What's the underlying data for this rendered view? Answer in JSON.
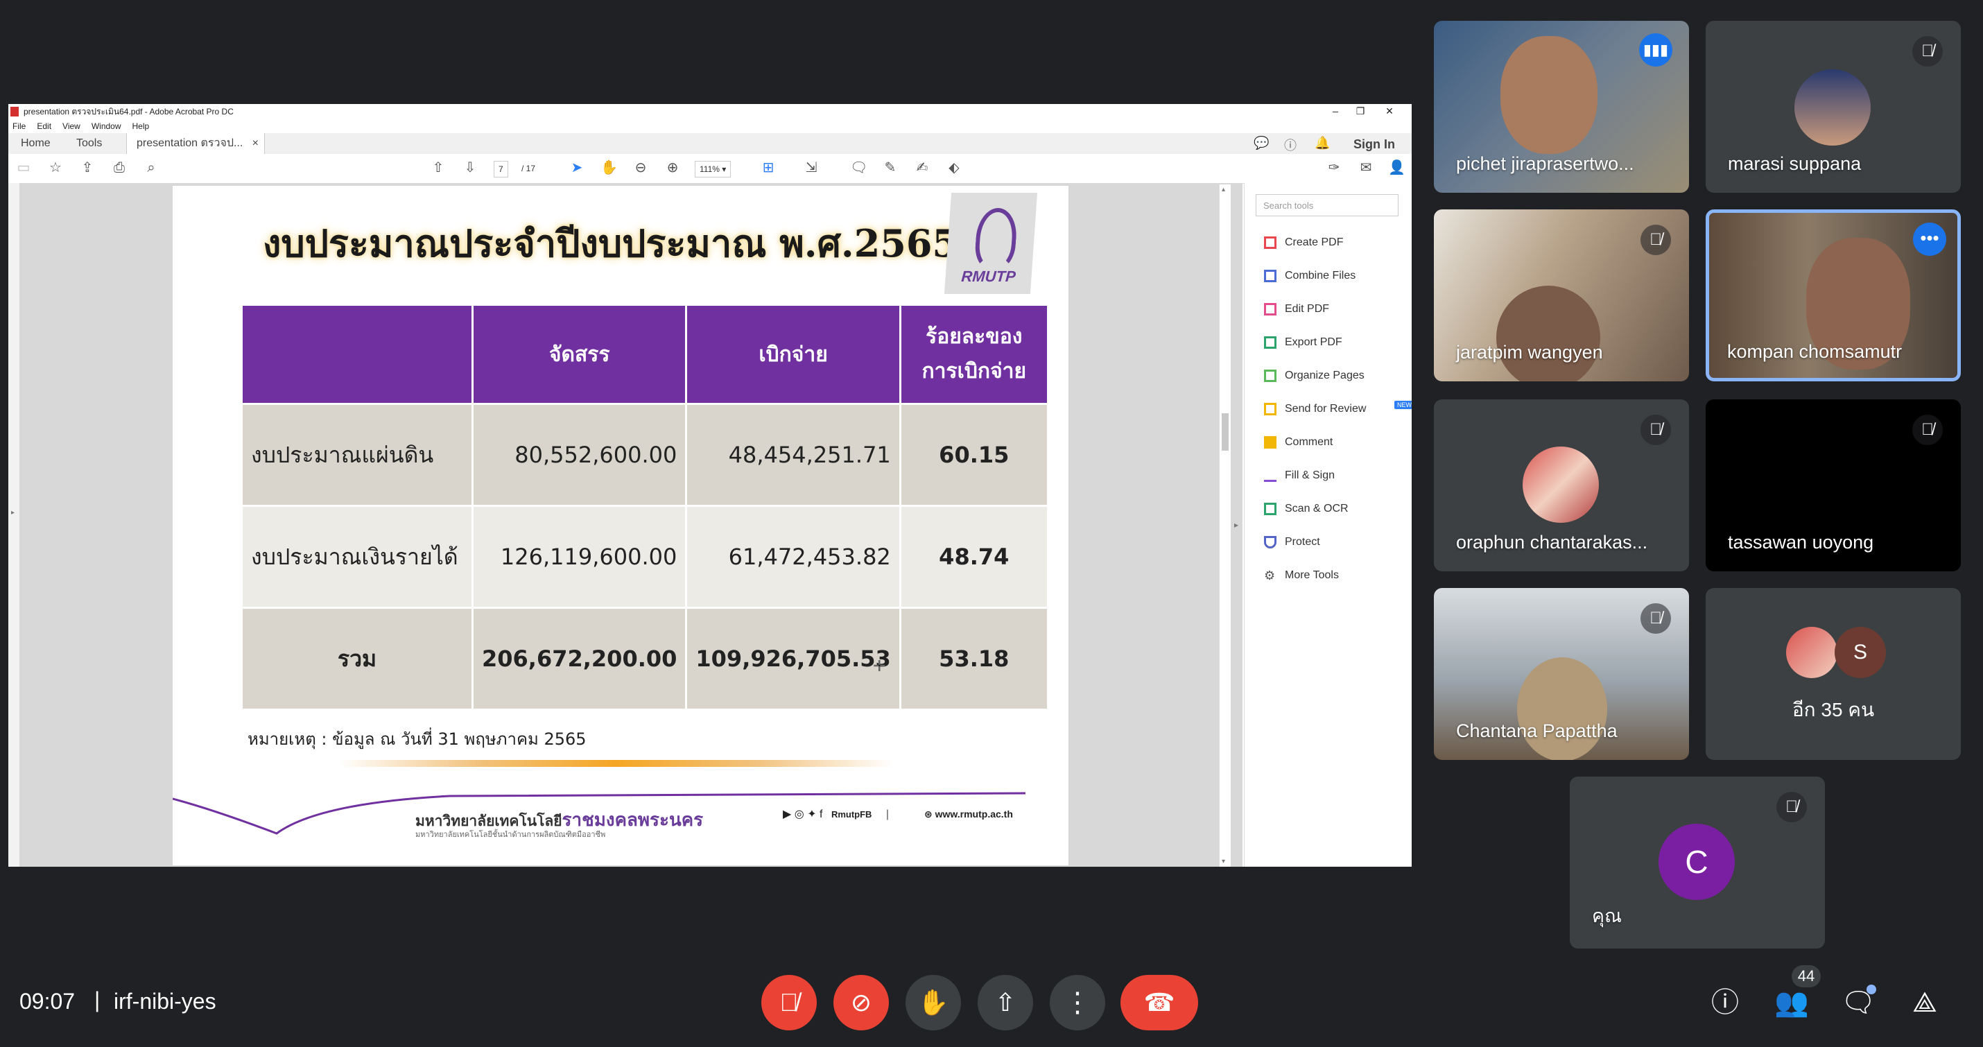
{
  "acrobat": {
    "title": "presentation ตรวจประเมิน64.pdf - Adobe Acrobat Pro DC",
    "menu": [
      "File",
      "Edit",
      "View",
      "Window",
      "Help"
    ],
    "tabs": {
      "home": "Home",
      "tools": "Tools",
      "doc": "presentation ตรวจป...",
      "close": "×"
    },
    "sign_in": "Sign In",
    "page_current": "7",
    "page_total": "/ 17",
    "zoom": "111%",
    "search_placeholder": "Search tools",
    "tools": [
      {
        "label": "Create PDF",
        "color": "#e8474f"
      },
      {
        "label": "Combine Files",
        "color": "#4b6bd6"
      },
      {
        "label": "Edit PDF",
        "color": "#e34d8b"
      },
      {
        "label": "Export PDF",
        "color": "#2ba56b"
      },
      {
        "label": "Organize Pages",
        "color": "#5cb85c"
      },
      {
        "label": "Send for Review",
        "color": "#f2b705"
      },
      {
        "label": "Comment",
        "color": "#f2b705"
      },
      {
        "label": "Fill & Sign",
        "color": "#8a4bd6"
      },
      {
        "label": "Scan & OCR",
        "color": "#2ba56b"
      },
      {
        "label": "Protect",
        "color": "#5564c7"
      },
      {
        "label": "More Tools",
        "color": "#555555"
      }
    ],
    "new_badge": "NEW"
  },
  "slide": {
    "title": "งบประมาณประจำปีงบประมาณ พ.ศ.2565",
    "logo_text": "RMUTP",
    "table": {
      "headers": [
        "",
        "จัดสรร",
        "เบิกจ่าย",
        "ร้อยละของการเบิกจ่าย"
      ],
      "rows": [
        [
          "งบประมาณแผ่นดิน",
          "80,552,600.00",
          "48,454,251.71",
          "60.15"
        ],
        [
          "งบประมาณเงินรายได้",
          "126,119,600.00",
          "61,472,453.82",
          "48.74"
        ],
        [
          "รวม",
          "206,672,200.00",
          "109,926,705.53",
          "53.18"
        ]
      ]
    },
    "note": "หมายเหตุ  : ข้อมูล ณ วันที่ 31 พฤษภาคม 2565",
    "university_prefix": "มหาวิทยาลัยเทคโนโลยี",
    "university_highlight": "ราชมงคลพระนคร",
    "university_sub": "มหาวิทยาลัยเทคโนโลยีชั้นนำด้านการผลิตบัณฑิตมืออาชีพ",
    "social_handle": "RmutpFB",
    "website": "www.rmutp.ac.th"
  },
  "participants": [
    {
      "name": "pichet jiraprasertwo...",
      "state": "speaking"
    },
    {
      "name": "marasi suppana",
      "state": "muted"
    },
    {
      "name": "jaratpim wangyen",
      "state": "muted"
    },
    {
      "name": "kompan chomsamutr",
      "state": "active"
    },
    {
      "name": "oraphun chantarakas...",
      "state": "muted"
    },
    {
      "name": "tassawan uoyong",
      "state": "muted"
    },
    {
      "name": "Chantana Papattha",
      "state": "muted"
    },
    {
      "name": "อีก 35 คน",
      "state": "others",
      "initial": "S"
    },
    {
      "name": "คุณ",
      "state": "muted",
      "initial": "C"
    }
  ],
  "meeting": {
    "time": "09:07",
    "separator": "|",
    "code": "irf-nibi-yes",
    "participant_count": "44"
  },
  "colors": {
    "background": "#202124",
    "tile": "#3c4043",
    "leave": "#ea4335",
    "accent_purple": "#7030a0",
    "highlight": "#8ab4f8"
  }
}
